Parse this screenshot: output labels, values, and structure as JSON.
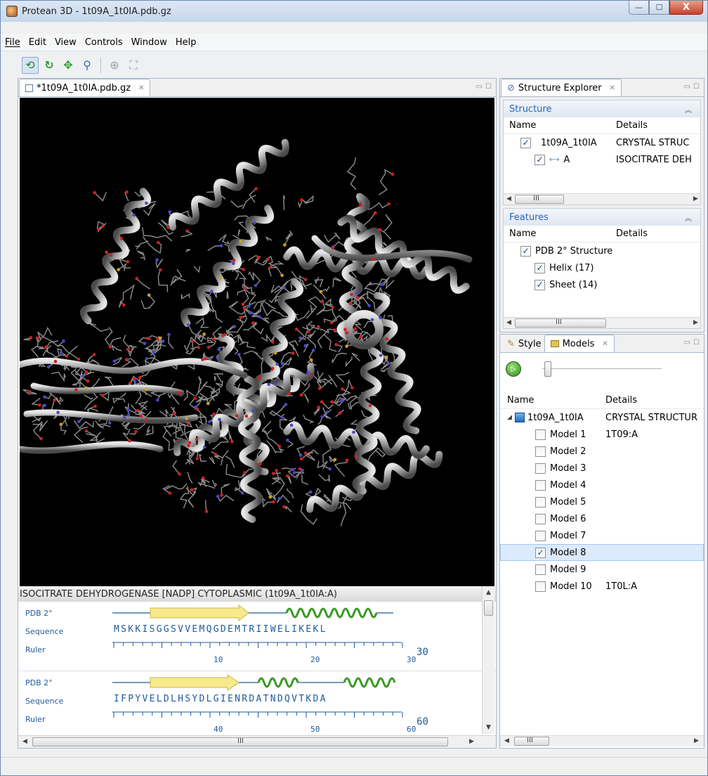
{
  "window": {
    "title": "Protean 3D - 1t09A_1t0IA.pdb.gz",
    "minimize": "—",
    "restore": "☐",
    "close": "X"
  },
  "menu": {
    "file": "File",
    "edit": "Edit",
    "view": "View",
    "controls": "Controls",
    "window": "Window",
    "help": "Help"
  },
  "toolbar": {
    "icons": [
      "rotate-icon",
      "refresh-icon",
      "move-icon",
      "zoom-icon",
      "center-icon",
      "fit-icon"
    ]
  },
  "editor": {
    "tab": "*1t09A_1t0IA.pdb.gz",
    "sequence_title": "ISOCITRATE DEHYDROGENASE [NADP] CYTOPLASMIC (1t09A_1t0IA:A)",
    "blocks": [
      {
        "label_pdb": "PDB 2°",
        "label_seq": "Sequence",
        "label_ruler": "Ruler",
        "sequence": "MSKKISGGSVVEMQGDEMTRIIWELIKEKL",
        "ticks": [
          "10",
          "20",
          "30"
        ],
        "end": "30"
      },
      {
        "label_pdb": "PDB 2°",
        "label_seq": "Sequence",
        "label_ruler": "Ruler",
        "sequence": "IFPYVELDLHSYDLGIENRDATNDQVTKDA",
        "ticks": [
          "40",
          "50",
          "60"
        ],
        "end": "60"
      }
    ],
    "scroll_mid": "III"
  },
  "structure_explorer": {
    "tab": "Structure Explorer",
    "structure": {
      "heading": "Structure",
      "col_name": "Name",
      "col_details": "Details",
      "rows": [
        {
          "name": "1t09A_1t0IA",
          "details": "CRYSTAL STRUC"
        },
        {
          "name": "A",
          "details": "ISOCITRATE DEH"
        }
      ]
    },
    "features": {
      "heading": "Features",
      "col_name": "Name",
      "col_details": "Details",
      "rows": [
        {
          "name": "PDB 2° Structure"
        },
        {
          "name": "Helix (17)"
        },
        {
          "name": "Sheet (14)"
        }
      ]
    },
    "scroll_mid": "III"
  },
  "models_panel": {
    "tab_style": "Style",
    "tab_models": "Models",
    "col_name": "Name",
    "col_details": "Details",
    "root": {
      "name": "1t09A_1t0IA",
      "details": "CRYSTAL STRUCTUR"
    },
    "models": [
      {
        "name": "Model 1",
        "details": "1T09:A",
        "checked": false
      },
      {
        "name": "Model 2",
        "details": "",
        "checked": false
      },
      {
        "name": "Model 3",
        "details": "",
        "checked": false
      },
      {
        "name": "Model 4",
        "details": "",
        "checked": false
      },
      {
        "name": "Model 5",
        "details": "",
        "checked": false
      },
      {
        "name": "Model 6",
        "details": "",
        "checked": false
      },
      {
        "name": "Model 7",
        "details": "",
        "checked": false
      },
      {
        "name": "Model 8",
        "details": "",
        "checked": true
      },
      {
        "name": "Model 9",
        "details": "",
        "checked": false
      },
      {
        "name": "Model 10",
        "details": "1T0L:A",
        "checked": false
      }
    ],
    "scroll_mid": "III"
  },
  "colors": {
    "accent": "#2a64b8",
    "seq": "#1f5a9a",
    "strand": "#f7e98c",
    "helix": "#3a9a23",
    "selected_row": "#dcebfc"
  }
}
